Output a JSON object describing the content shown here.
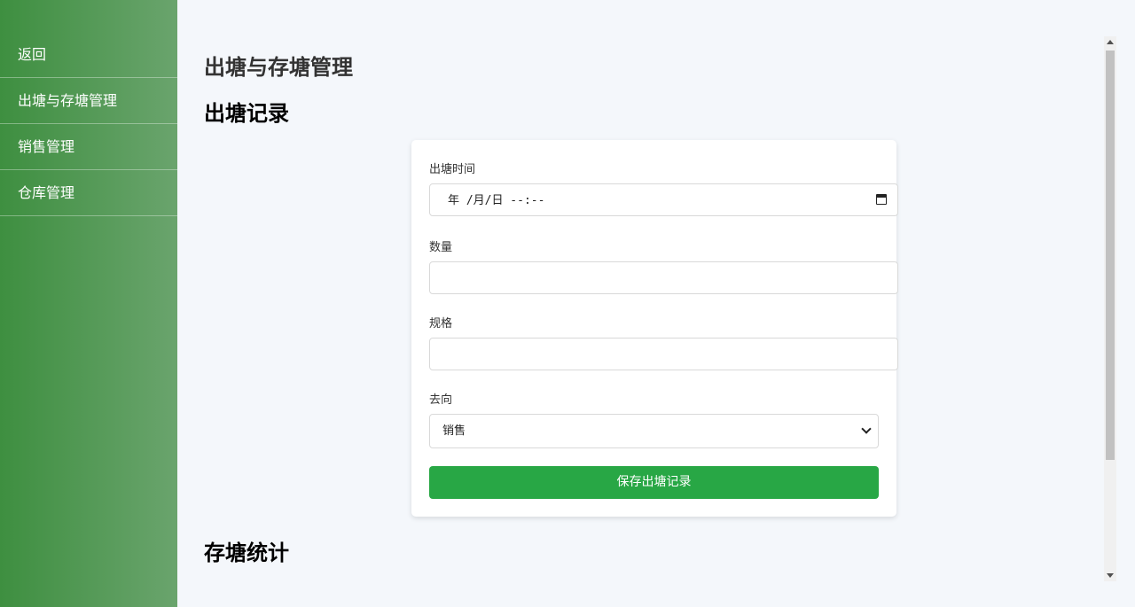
{
  "sidebar": {
    "items": [
      {
        "label": "返回"
      },
      {
        "label": "出塘与存塘管理"
      },
      {
        "label": "销售管理"
      },
      {
        "label": "仓库管理"
      }
    ]
  },
  "main": {
    "page_title": "出塘与存塘管理",
    "section_outflow": "出塘记录",
    "section_stock": "存塘统计"
  },
  "form": {
    "time_label": "出塘时间",
    "time_placeholder": "年 /月/日 --:--",
    "quantity_label": "数量",
    "quantity_value": "",
    "spec_label": "规格",
    "spec_value": "",
    "destination_label": "去向",
    "destination_selected": "销售",
    "save_label": "保存出塘记录"
  },
  "colors": {
    "sidebar_start": "#3e8f40",
    "sidebar_end": "#6aa46d",
    "primary_button": "#28a745"
  }
}
